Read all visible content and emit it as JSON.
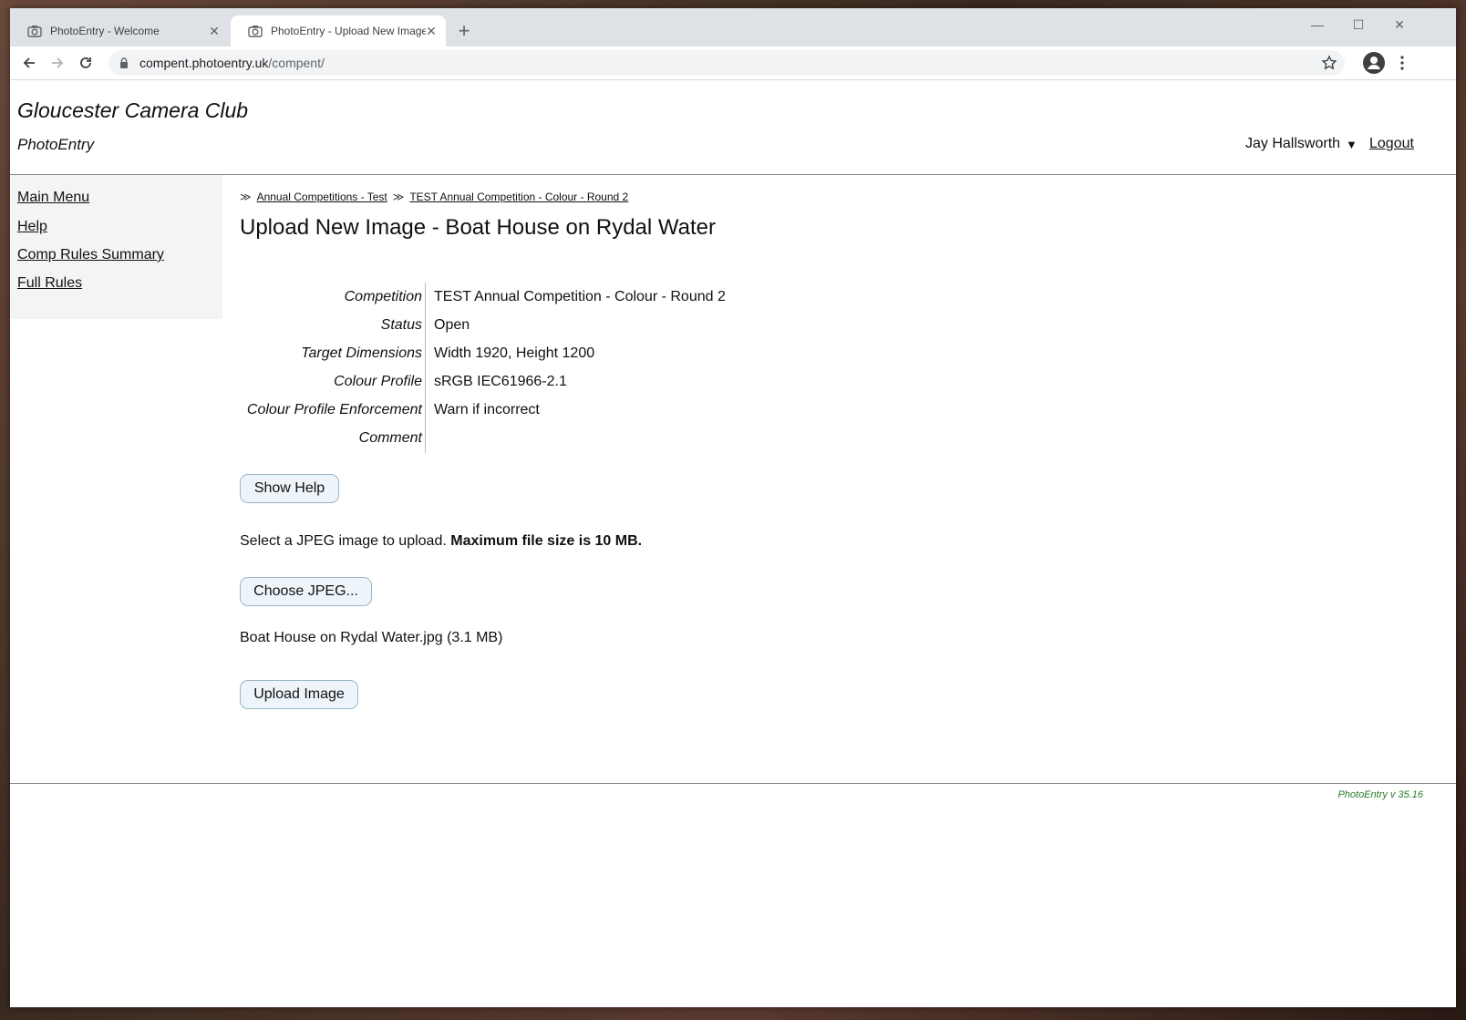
{
  "browser": {
    "tabs": [
      {
        "title": "PhotoEntry - Welcome",
        "icon": "camera-icon"
      },
      {
        "title": "PhotoEntry - Upload New Image",
        "icon": "camera-icon"
      }
    ],
    "url_host": "compent.photoentry.uk",
    "url_path": "/compent/"
  },
  "header": {
    "site_title": "Gloucester Camera Club",
    "site_subtitle": "PhotoEntry",
    "user_name": "Jay Hallsworth",
    "logout_label": "Logout"
  },
  "sidebar": {
    "items": [
      {
        "label": "Main Menu"
      },
      {
        "label": "Help"
      },
      {
        "label": "Comp Rules Summary"
      },
      {
        "label": "Full Rules"
      }
    ]
  },
  "breadcrumb": {
    "sep": "≫",
    "items": [
      {
        "label": "Annual Competitions - Test"
      },
      {
        "label": "TEST Annual Competition - Colour - Round 2"
      }
    ]
  },
  "main": {
    "title": "Upload New Image - Boat House on Rydal Water",
    "details": [
      {
        "label": "Competition",
        "value": "TEST Annual Competition - Colour - Round 2"
      },
      {
        "label": "Status",
        "value": "Open"
      },
      {
        "label": "Target Dimensions",
        "value": "Width 1920, Height 1200"
      },
      {
        "label": "Colour Profile",
        "value": "sRGB IEC61966-2.1"
      },
      {
        "label": "Colour Profile Enforcement",
        "value": "Warn if incorrect"
      },
      {
        "label": "Comment",
        "value": ""
      }
    ],
    "show_help_label": "Show Help",
    "select_text": "Select a JPEG image to upload.",
    "max_size_text": "Maximum file size is 10 MB.",
    "choose_label": "Choose JPEG...",
    "selected_file": "Boat House on Rydal Water.jpg (3.1 MB)",
    "upload_label": "Upload Image"
  },
  "footer": {
    "version": "PhotoEntry v 35.16"
  },
  "colors": {
    "version_text": "#2a7a2a",
    "button_bg": "#eef5fa",
    "button_border": "#9bb6c8"
  }
}
